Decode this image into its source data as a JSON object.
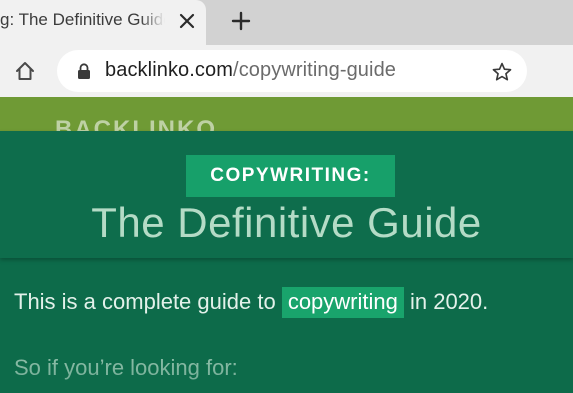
{
  "browser": {
    "tab": {
      "title": "g: The Definitive Guide",
      "close_icon": "close-icon"
    },
    "new_tab_icon": "plus-icon",
    "toolbar": {
      "home_icon": "home-icon",
      "lock_icon": "lock-icon",
      "url_domain": "backlinko.com",
      "url_path": "/copywriting-guide",
      "star_icon": "star-icon"
    }
  },
  "page": {
    "logo": "BACKLINKO",
    "badge": "COPYWRITING:",
    "title": "The Definitive Guide",
    "intro": {
      "before": "This is a complete guide to ",
      "highlight": "copywriting",
      "after": " in 2020."
    },
    "followup": "So if you’re looking for:"
  },
  "colors": {
    "page_bg": "#0d6b4a",
    "badge_bg": "#17a06a",
    "header_green": "#6f9a35",
    "title_text": "#b4dbc6"
  }
}
